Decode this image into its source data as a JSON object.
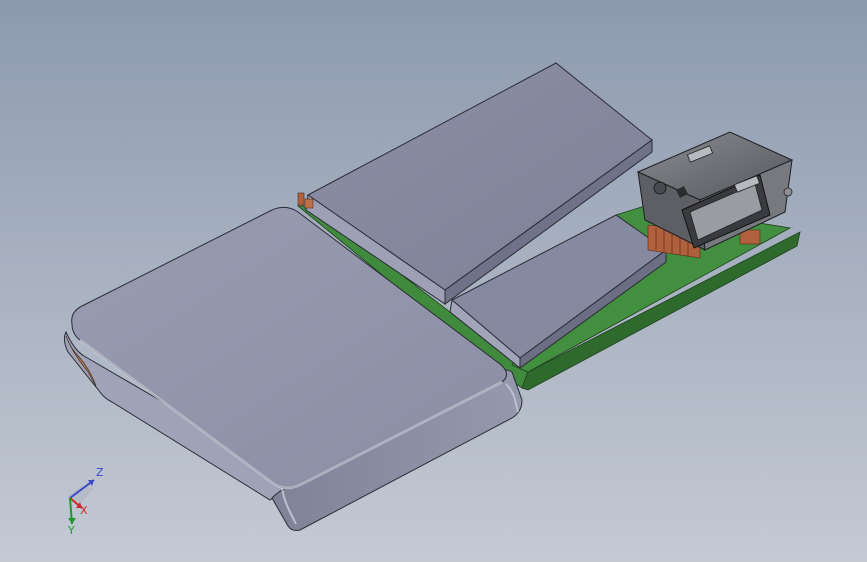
{
  "viewport": {
    "background_top": "#8d9aae",
    "background_bottom": "#c4cad4"
  },
  "model": {
    "battery_large_color": "#8f92a8",
    "battery_small_color": "#858aa0",
    "pcb_color": "#3f8a3c",
    "pad_color": "#b0603c",
    "connector_color": "#6e7076"
  },
  "triad": {
    "z_label": "Z",
    "x_label": "X",
    "y_label": "Y",
    "z_color": "#3b48c8",
    "x_color": "#d02828",
    "y_color": "#1e9a2a"
  }
}
